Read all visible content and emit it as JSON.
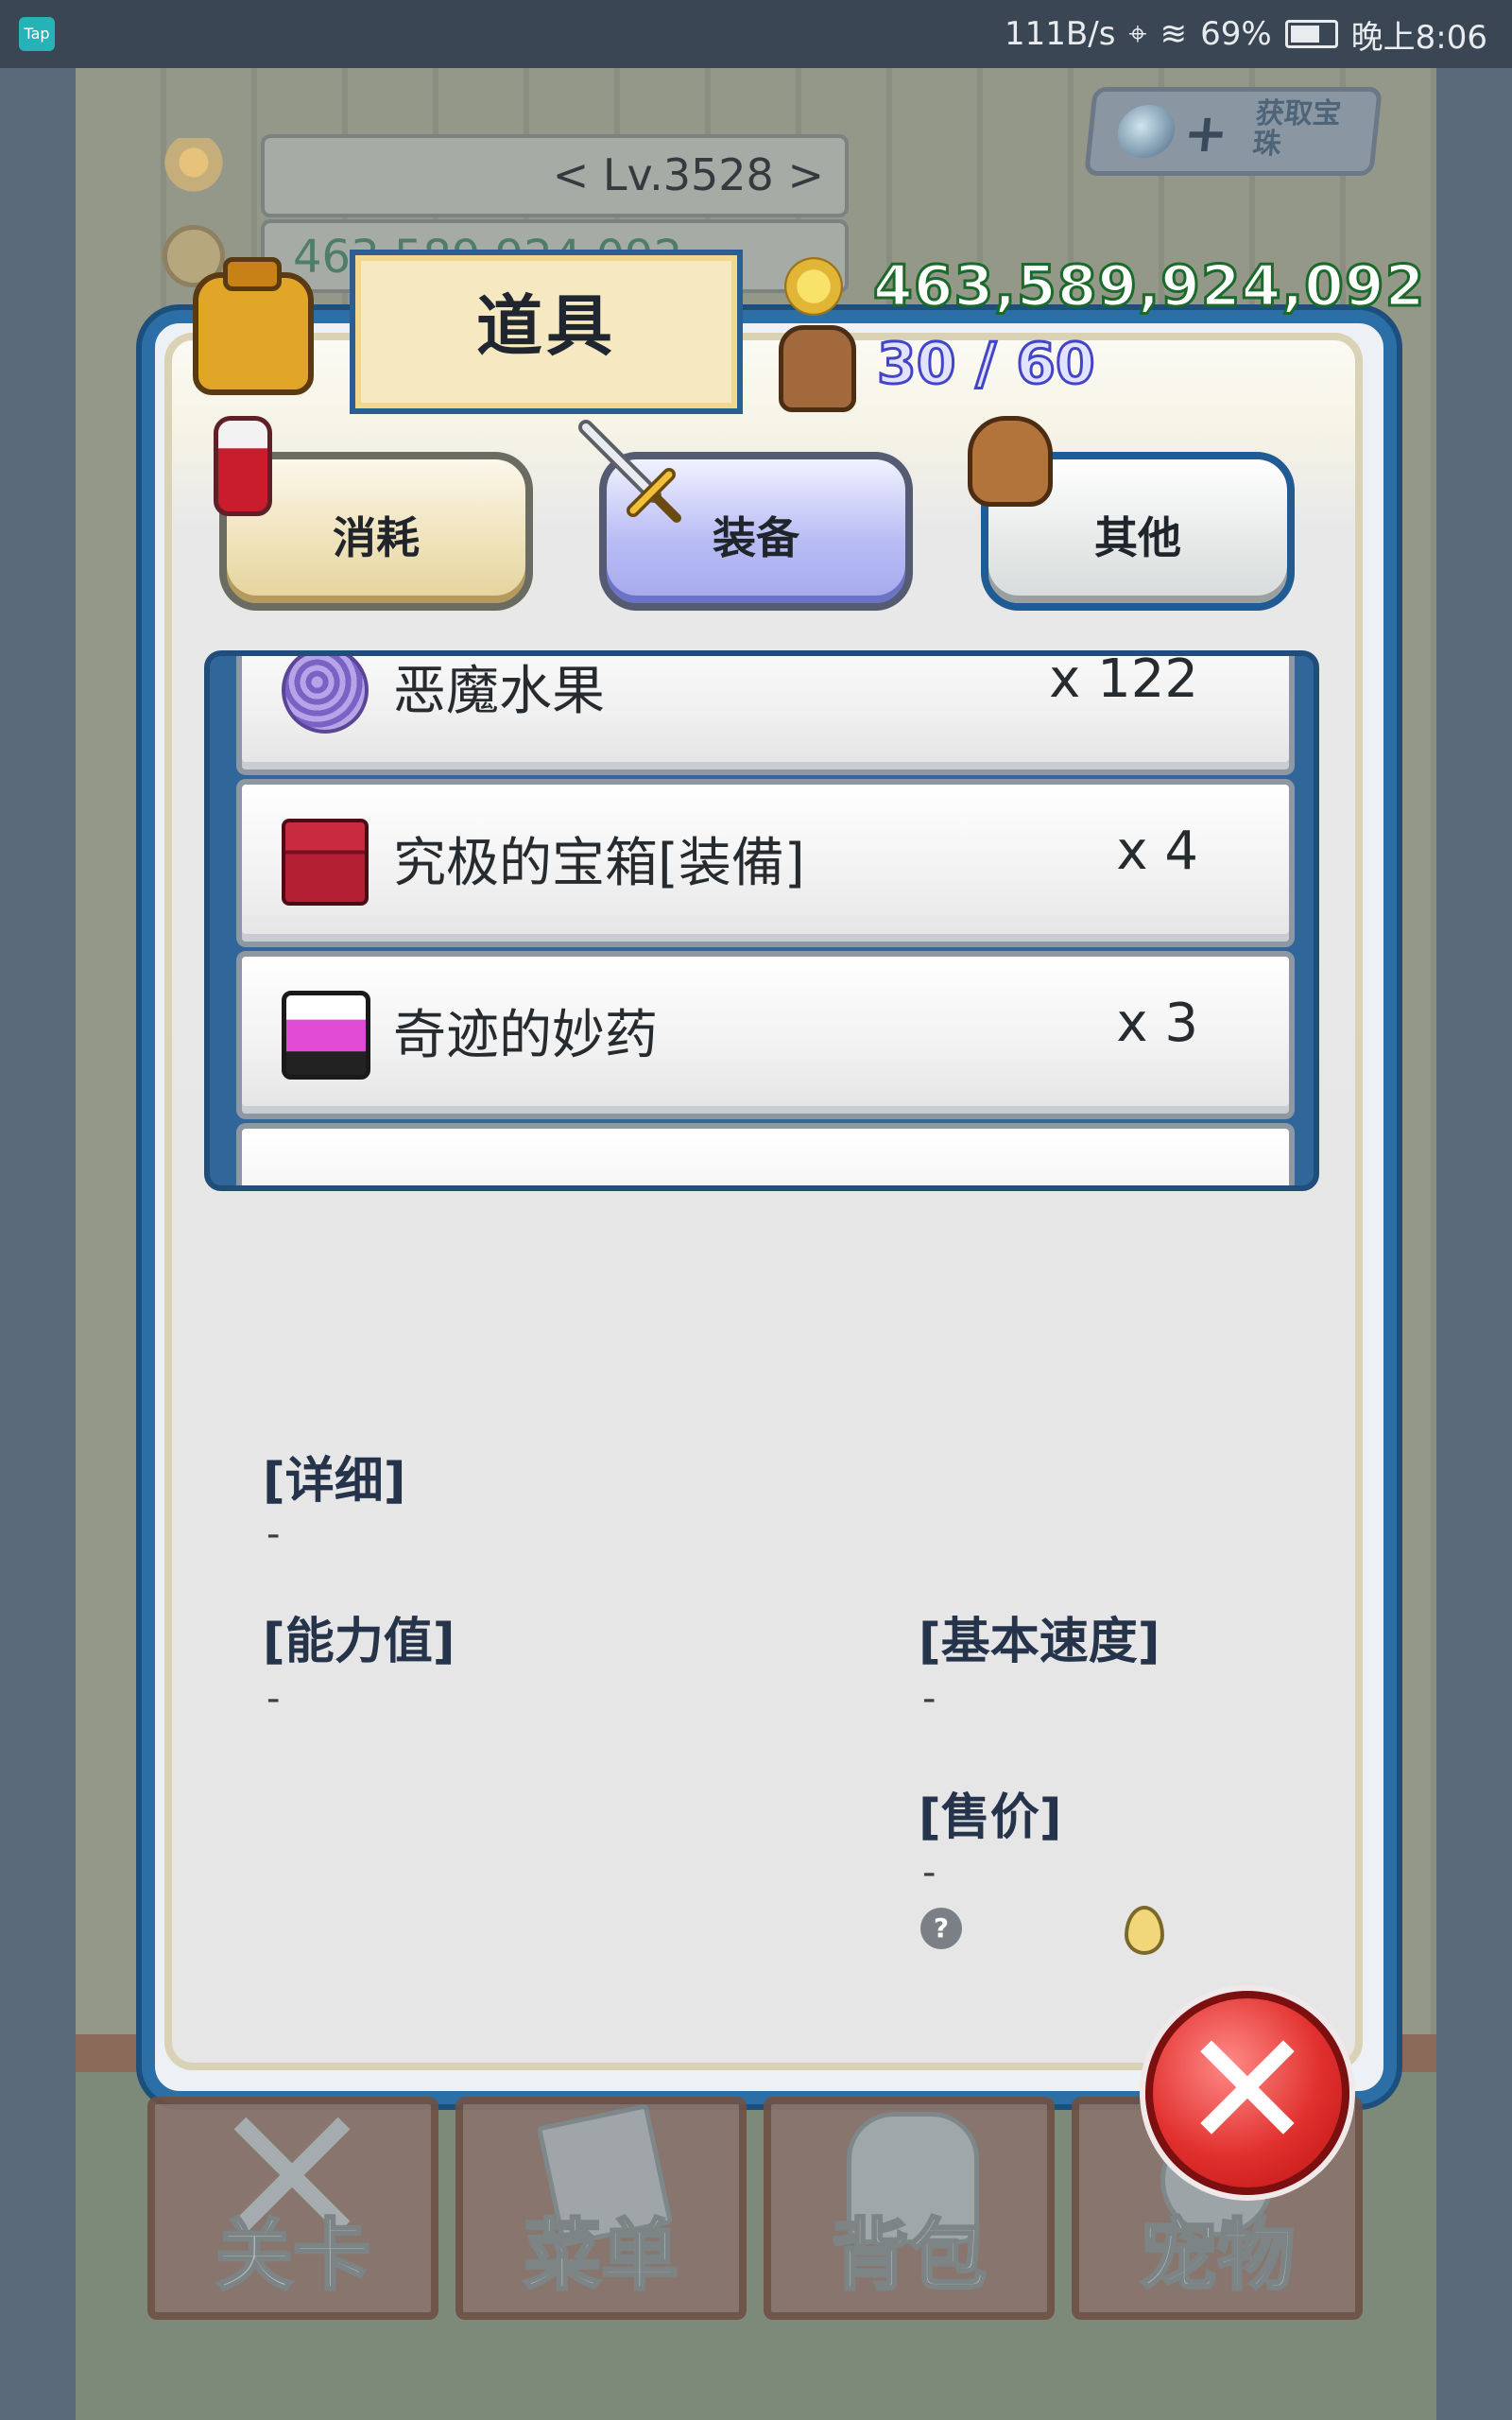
{
  "status_bar": {
    "app_badge": "Tap",
    "speed": "111B/s",
    "battery": "69%",
    "battery_level": 0.69,
    "time": "晚上8:06"
  },
  "hud": {
    "level": "< Lv.3528 >",
    "gold_behind": "463,589,924,092"
  },
  "get_gem_button": {
    "label": "获取宝珠"
  },
  "panel": {
    "title": "道具",
    "gold": "463,589,924,092",
    "capacity": "30 / 60"
  },
  "tabs": [
    {
      "label": "消耗",
      "selected": false
    },
    {
      "label": "装备",
      "selected": true
    },
    {
      "label": "其他",
      "selected": false
    }
  ],
  "items": [
    {
      "name": "恶魔水果",
      "qty": "x 122",
      "icon": "devil-fruit-icon"
    },
    {
      "name": "究极的宝箱[装備]",
      "qty": "x 4",
      "icon": "treasure-chest-icon"
    },
    {
      "name": "奇迹的妙药",
      "qty": "x 3",
      "icon": "miracle-elixir-icon"
    }
  ],
  "details": {
    "detail_label": "[详细]",
    "detail_value": "-",
    "ability_label": "[能力值]",
    "ability_value": "-",
    "speed_label": "[基本速度]",
    "speed_value": "-",
    "price_label": "[售价]",
    "price_value": "-",
    "help_glyph": "?"
  },
  "bottom_nav": [
    {
      "label": "关卡"
    },
    {
      "label": "菜单"
    },
    {
      "label": "背包"
    },
    {
      "label": "宠物"
    }
  ],
  "colors": {
    "panel_border": "#2b6fa6",
    "gold_text_outline": "#1a6a2a",
    "capacity_text_outline": "#4345c6",
    "close_button": "#e1302e"
  }
}
